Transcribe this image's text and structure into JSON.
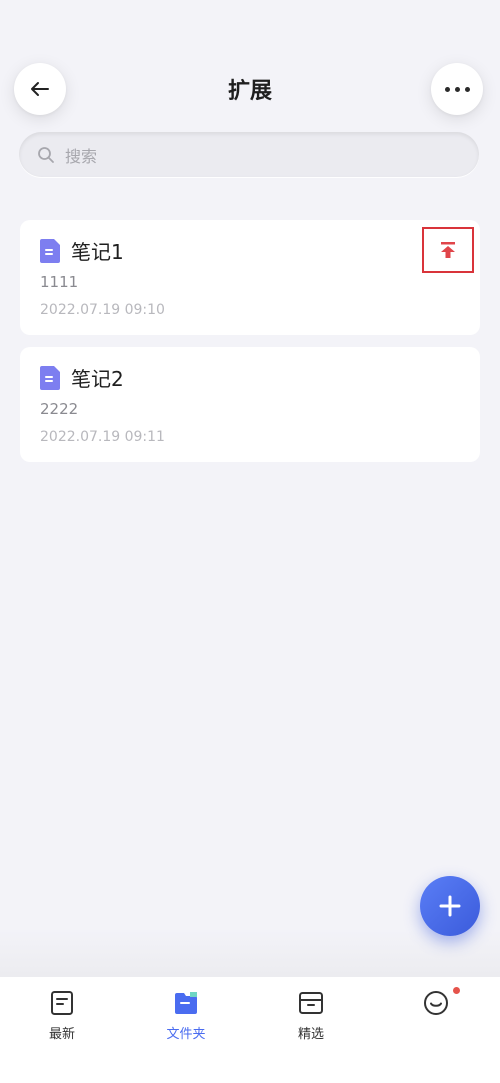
{
  "header": {
    "title": "扩展"
  },
  "search": {
    "placeholder": "搜索"
  },
  "notes": [
    {
      "title": "笔记1",
      "preview": "1111",
      "date": "2022.07.19 09:10",
      "pinned_highlight": true
    },
    {
      "title": "笔记2",
      "preview": "2222",
      "date": "2022.07.19 09:11"
    }
  ],
  "nav": {
    "items": [
      {
        "label": "最新",
        "icon": "document-icon"
      },
      {
        "label": "文件夹",
        "icon": "folder-icon",
        "active": true
      },
      {
        "label": "精选",
        "icon": "archive-box-icon"
      },
      {
        "label": "",
        "icon": "smiley-icon",
        "badge": true
      }
    ]
  },
  "colors": {
    "accent": "#4a6cf0",
    "pin": "#d9343a",
    "doc_icon": "#7d7ef0"
  }
}
